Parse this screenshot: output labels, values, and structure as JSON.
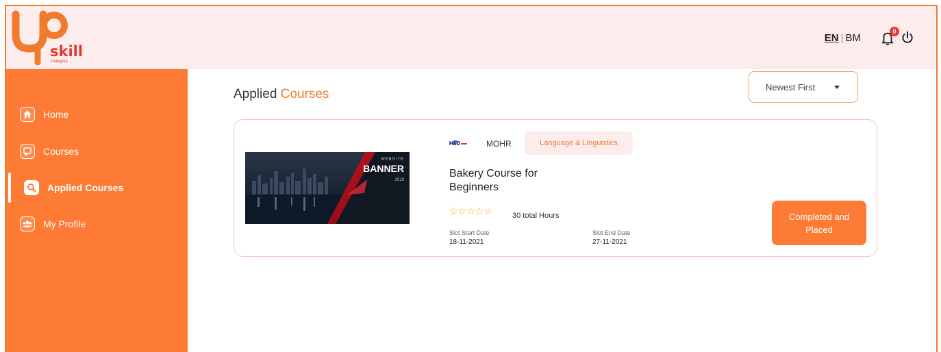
{
  "header": {
    "logo_text": "skill",
    "logo_sub": "malaysia",
    "lang_en": "EN",
    "lang_sep": "|",
    "lang_bm": "BM",
    "notification_count": "0"
  },
  "sidebar": {
    "items": [
      {
        "label": "Home",
        "icon": "home-icon"
      },
      {
        "label": "Courses",
        "icon": "courses-icon"
      },
      {
        "label": "Applied Courses",
        "icon": "search-icon"
      },
      {
        "label": "My Profile",
        "icon": "users-icon"
      }
    ]
  },
  "main": {
    "title_part1": "Applied ",
    "title_part2": "Courses",
    "sort_label": "Newest First"
  },
  "course": {
    "provider_logo_text": "HRD",
    "provider": "MOHR",
    "category": "Language & Linguistics",
    "title": "Bakery Course for Beginners",
    "stars": "☆☆☆☆☆",
    "hours": "30 total Hours",
    "slot_start_label": "Slot Start Date",
    "slot_start_value": "18-11-2021",
    "slot_end_label": "Slot End Date",
    "slot_end_value": "27-11-2021",
    "status": "Completed and Placed",
    "banner": {
      "small_title": "WEBSITE",
      "big_title": "BANNER",
      "year": "2019"
    }
  },
  "colors": {
    "accent": "#fd7b35",
    "header_bg": "#fdecec",
    "star": "#e8b400"
  }
}
